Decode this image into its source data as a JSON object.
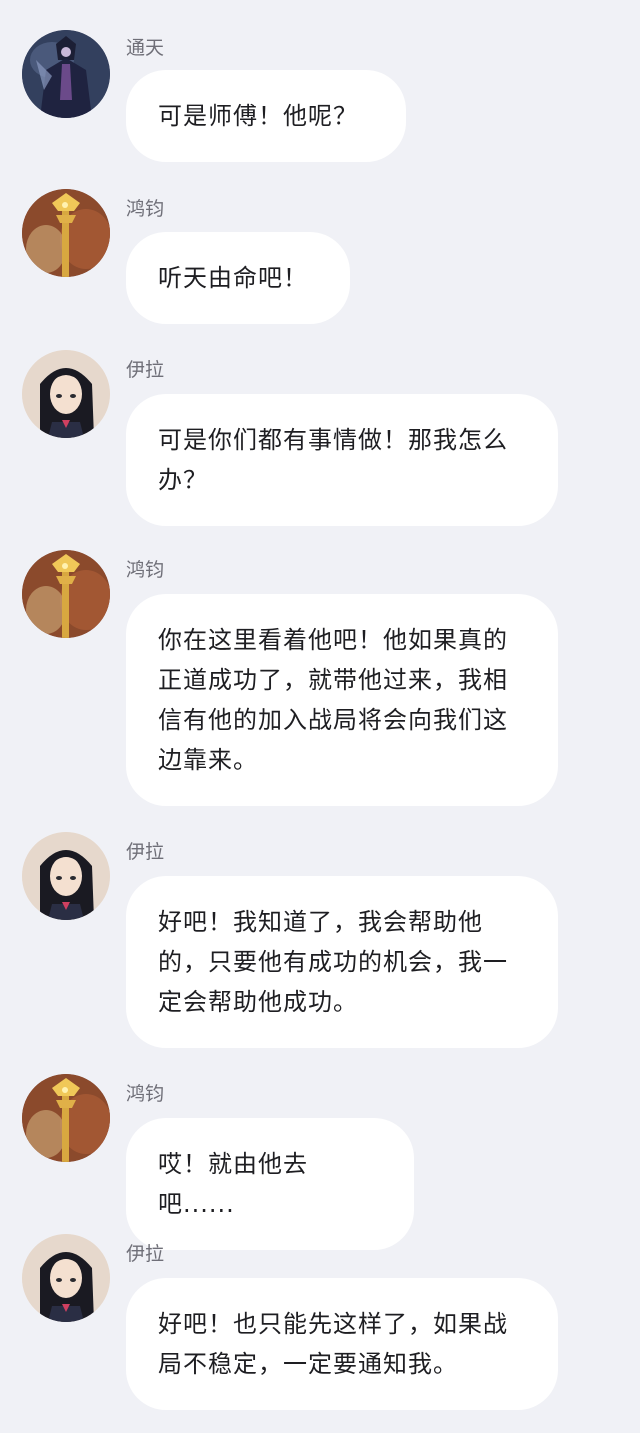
{
  "messages": [
    {
      "sender": "通天",
      "avatar": "dark-armored-warrior-avatar",
      "text": "可是师傅！他呢？"
    },
    {
      "sender": "鸿钧",
      "avatar": "golden-staff-sage-avatar",
      "text": "听天由命吧！"
    },
    {
      "sender": "伊拉",
      "avatar": "anime-girl-dark-hair-avatar",
      "text": "可是你们都有事情做！那我怎么办？"
    },
    {
      "sender": "鸿钧",
      "avatar": "golden-staff-sage-avatar",
      "text": "你在这里看着他吧！他如果真的正道成功了，就带他过来，我相信有他的加入战局将会向我们这边靠来。"
    },
    {
      "sender": "伊拉",
      "avatar": "anime-girl-dark-hair-avatar",
      "text": "好吧！我知道了，我会帮助他的，只要他有成功的机会，我一定会帮助他成功。"
    },
    {
      "sender": "鸿钧",
      "avatar": "golden-staff-sage-avatar",
      "text": "哎！就由他去吧......"
    },
    {
      "sender": "伊拉",
      "avatar": "anime-girl-dark-hair-avatar",
      "text": "好吧！也只能先这样了，如果战局不稳定，一定要通知我。"
    }
  ],
  "colors": {
    "background": "#f0f1f6",
    "bubble": "#ffffff",
    "name_text": "#6f6f78",
    "message_text": "#1e1e22"
  }
}
